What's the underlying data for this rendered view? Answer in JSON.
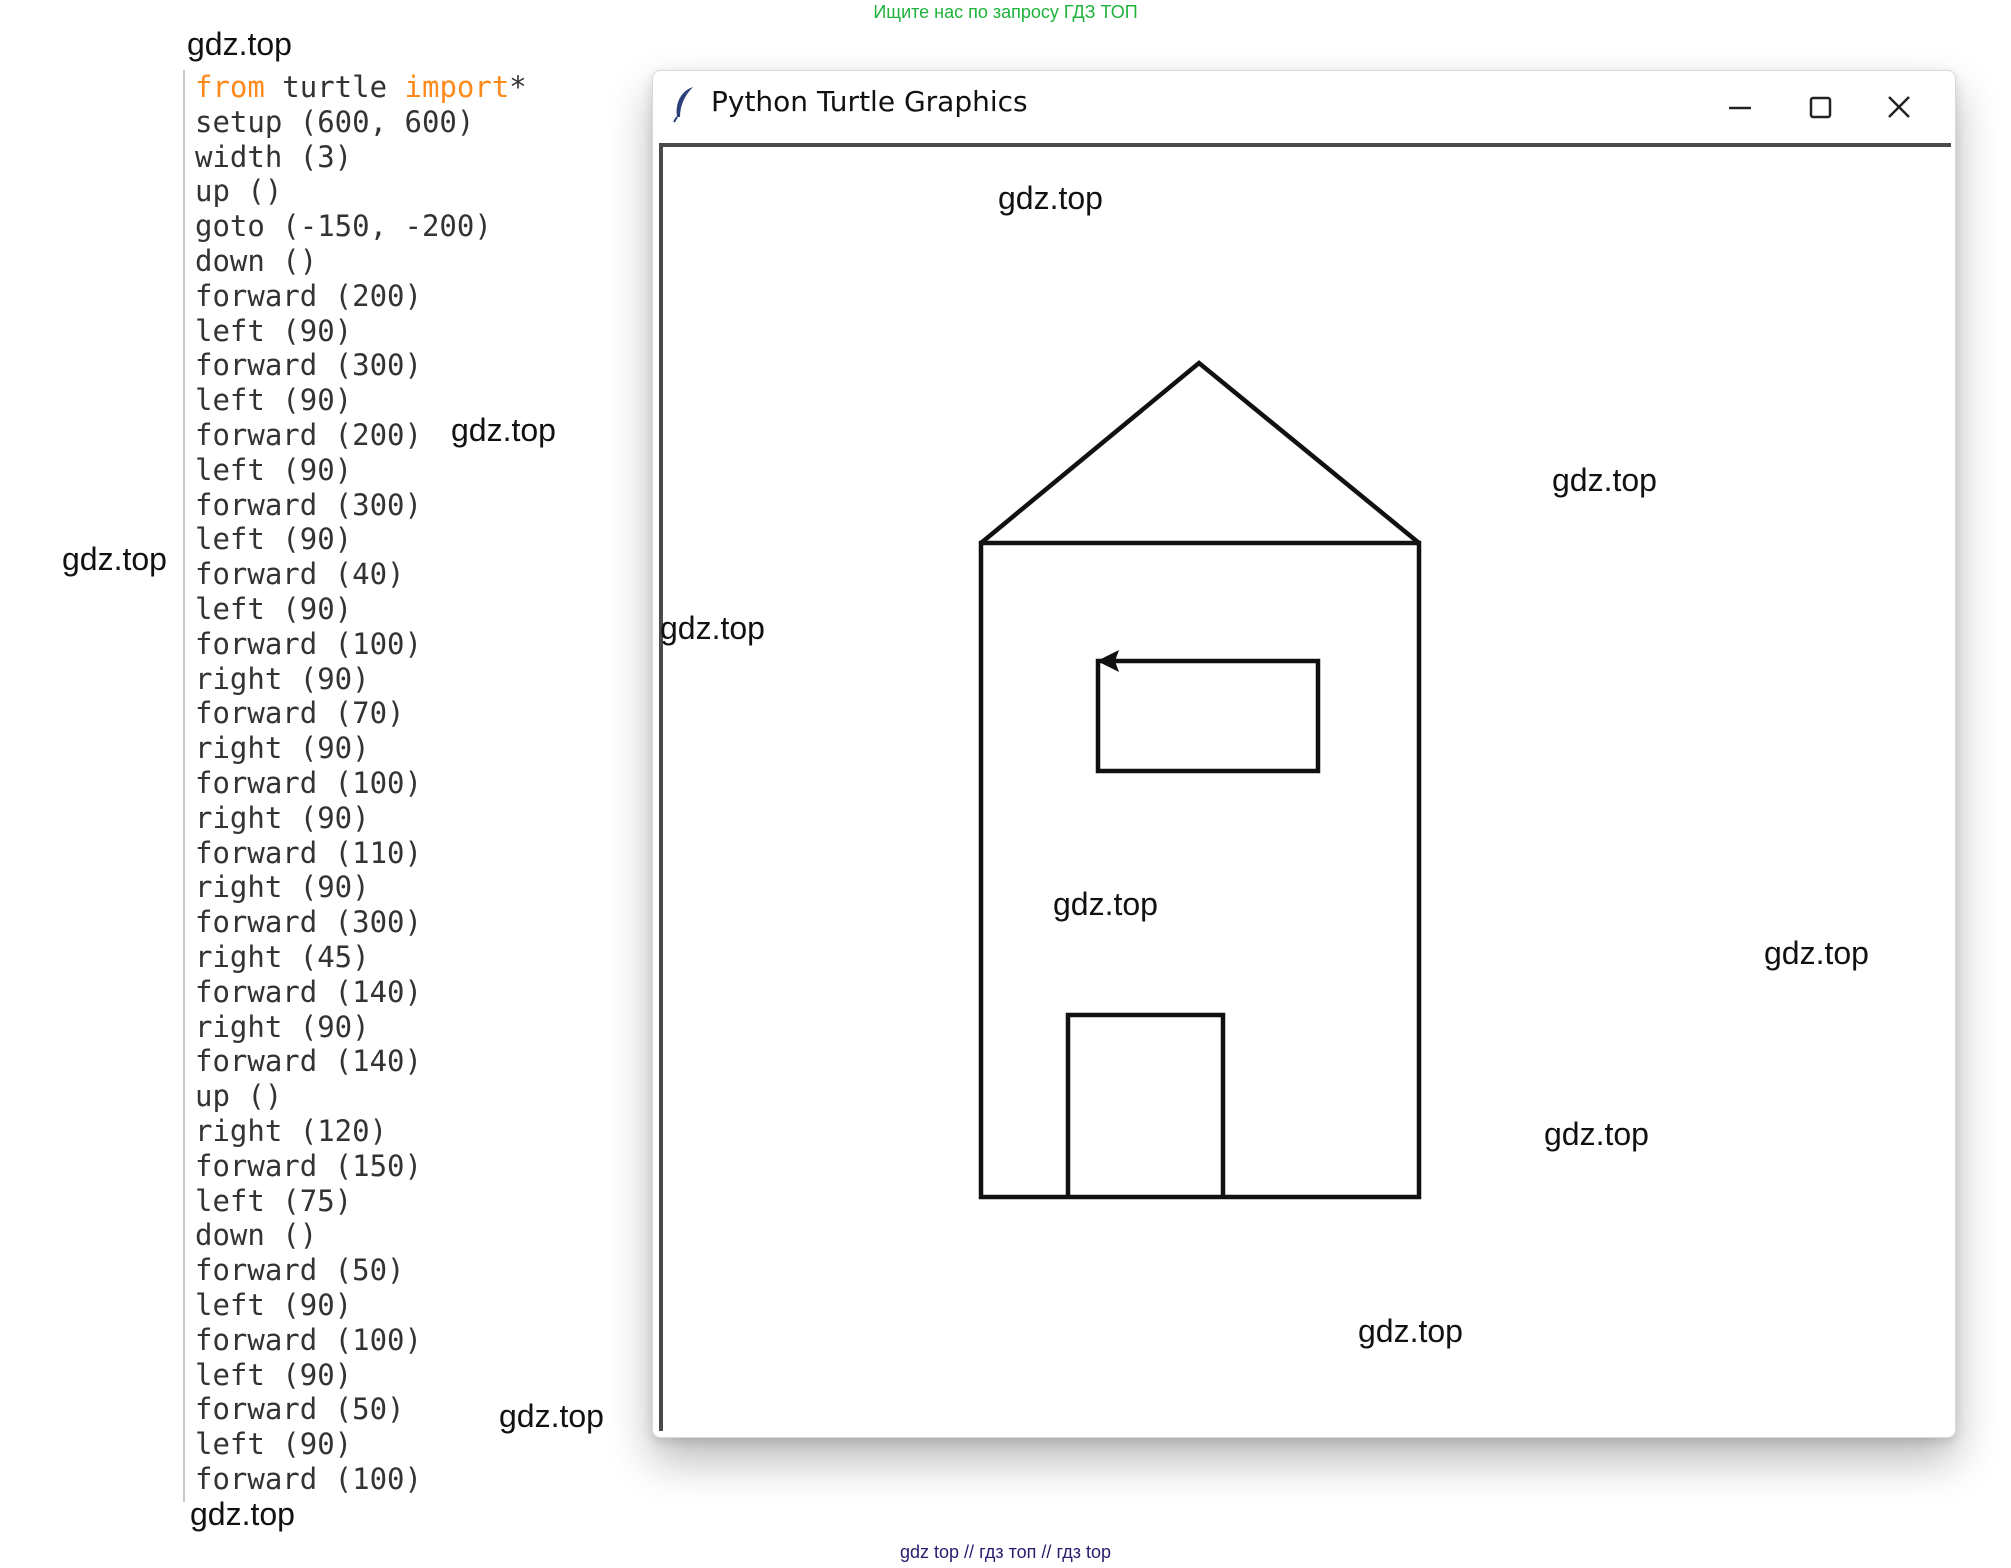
{
  "banner": {
    "text": "Ищите нас по запросу ГДЗ ТОП"
  },
  "footer": {
    "links": [
      "gdz top",
      "//",
      "гдз топ",
      "//",
      "гдз top"
    ]
  },
  "watermarks": [
    "gdz.top",
    "gdz.top",
    "gdz.top",
    "gdz.top",
    "gdz.top",
    "gdz.top",
    "gdz.top",
    "gdz.top",
    "gdz.top",
    "gdz.top",
    "gdz.top",
    "gdz.top"
  ],
  "code": {
    "first_line": {
      "kw1": "from",
      "module": " turtle ",
      "kw2": "import",
      "star": "*"
    },
    "lines": [
      "setup (600, 600)",
      "width (3)",
      "up ()",
      "goto (-150, -200)",
      "down ()",
      "forward (200)",
      "left (90)",
      "forward (300)",
      "left (90)",
      "forward (200)",
      "left (90)",
      "forward (300)",
      "left (90)",
      "forward (40)",
      "left (90)",
      "forward (100)",
      "right (90)",
      "forward (70)",
      "right (90)",
      "forward (100)",
      "right (90)",
      "forward (110)",
      "right (90)",
      "forward (300)",
      "right (45)",
      "forward (140)",
      "right (90)",
      "forward (140)",
      "up ()",
      "right (120)",
      "forward (150)",
      "left (75)",
      "down ()",
      "forward (50)",
      "left (90)",
      "forward (100)",
      "left (90)",
      "forward (50)",
      "left (90)",
      "forward (100)"
    ]
  },
  "window": {
    "title": "Python Turtle Graphics",
    "icon": "feather-icon",
    "buttons": [
      "minimize-icon",
      "maximize-icon",
      "close-icon"
    ]
  },
  "colors": {
    "keyword": "#ff8a1c",
    "code_text": "#333333",
    "banner": "#1db33a",
    "footer": "#2a1a6e",
    "stroke": "#111111"
  }
}
